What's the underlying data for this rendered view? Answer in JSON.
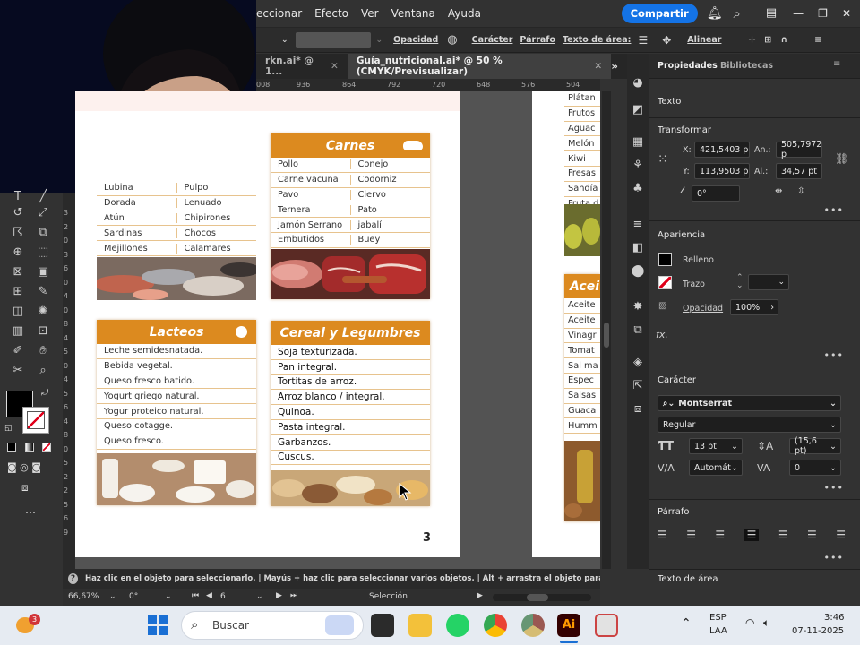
{
  "menubar": {
    "items": [
      "eccionar",
      "Efecto",
      "Ver",
      "Ventana",
      "Ayuda"
    ],
    "share_label": "Compartir"
  },
  "controlbar": {
    "opacity_label": "Opacidad",
    "character_label": "Carácter",
    "paragraph_label": "Párrafo",
    "area_text_label": "Texto de área:",
    "align_label": "Alinear"
  },
  "tabs": [
    {
      "label": "rkn.ai* @ 1..."
    },
    {
      "label": "Guía_nutricional.ai* @ 50 % (CMYK/Previsualizar)"
    }
  ],
  "ruler": {
    "h_ticks": [
      "008",
      "936",
      "864",
      "792",
      "720",
      "648",
      "576",
      "504"
    ],
    "v_ticks": [
      "3",
      "2",
      "0",
      "3",
      "6",
      "0",
      "4",
      "0",
      "8",
      "4",
      "5",
      "0",
      "4",
      "5",
      "6",
      "4",
      "8",
      "0",
      "5",
      "2",
      "2",
      "5",
      "6",
      "9"
    ]
  },
  "cards": {
    "pescados": {
      "rows": [
        [
          "Lubina",
          "Pulpo"
        ],
        [
          "Dorada",
          "Lenuado"
        ],
        [
          "Atún",
          "Chipirones"
        ],
        [
          "Sardinas",
          "Chocos"
        ],
        [
          "Mejillones",
          "Calamares"
        ]
      ]
    },
    "carnes": {
      "title": "Carnes",
      "rows": [
        [
          "Pollo",
          "Conejo"
        ],
        [
          "Carne vacuna",
          "Codorniz"
        ],
        [
          "Pavo",
          "Ciervo"
        ],
        [
          "Ternera",
          "Pato"
        ],
        [
          "Jamón Serrano",
          "jabalí"
        ],
        [
          "Embutidos",
          "Buey"
        ]
      ]
    },
    "lacteos": {
      "title": "Lacteos",
      "items": [
        "Leche semidesnatada.",
        "Bebida vegetal.",
        "Queso fresco batido.",
        "Yogurt griego natural.",
        "Yogur proteico natural.",
        "Queso cotagge.",
        "Queso fresco."
      ]
    },
    "cereal": {
      "title": "Cereal y Legumbres",
      "items": [
        "Soja texturizada.",
        "Pan integral.",
        "Tortitas de arroz.",
        "Arroz blanco / integral.",
        "Quinoa.",
        "Pasta integral.",
        "Garbanzos.",
        "Cuscus."
      ]
    }
  },
  "page_number": "3",
  "page2": {
    "fruits": [
      "Plátan",
      "Frutos",
      "Aguac",
      "Melón",
      "Kiwi",
      "Fresas",
      "Sandía",
      "Fruta d"
    ],
    "aceites_title": "Acei",
    "aceites": [
      "Aceite",
      "Aceite",
      "Vinagr",
      "Tomat",
      "Sal ma",
      "Espec",
      "Salsas",
      "Guaca",
      "Humm"
    ]
  },
  "panel": {
    "tabs": [
      "Propiedades",
      "Bibliotecas"
    ],
    "text_title": "Texto",
    "transform_title": "Transformar",
    "x_label": "X:",
    "x_value": "421,5403 p",
    "y_label": "Y:",
    "y_value": "113,9503 p",
    "w_label": "An.:",
    "w_value": "505,7972 p",
    "h_label": "Al.:",
    "h_value": "34,57 pt",
    "angle_value": "0°",
    "appearance_title": "Apariencia",
    "fill_label": "Relleno",
    "stroke_label": "Trazo",
    "opacity_label": "Opacidad",
    "opacity_value": "100%",
    "fx_label": "fx.",
    "character_title": "Carácter",
    "font_value": "Montserrat",
    "style_value": "Regular",
    "size_value": "13 pt",
    "leading_value": "(15,6 pt)",
    "kerning_value": "Automát",
    "tracking_value": "0",
    "paragraph_title": "Párrafo",
    "area_text_title": "Texto de área"
  },
  "status": {
    "hint": "Haz clic en el objeto para seleccionarlo. | Mayús + haz clic para seleccionar varios objetos. | Alt + arrastra el objeto para duplicarlo",
    "zoom": "66,67%",
    "rotation": "0°",
    "artboard": "6",
    "tool": "Selección"
  },
  "taskbar": {
    "search_placeholder": "Buscar",
    "badge": "3",
    "lang": "ESP",
    "lang2": "LAA",
    "time": "3:46",
    "date": "07-11-2025"
  },
  "colors": {
    "accent": "#dc8a1f",
    "share": "#1473e6"
  }
}
